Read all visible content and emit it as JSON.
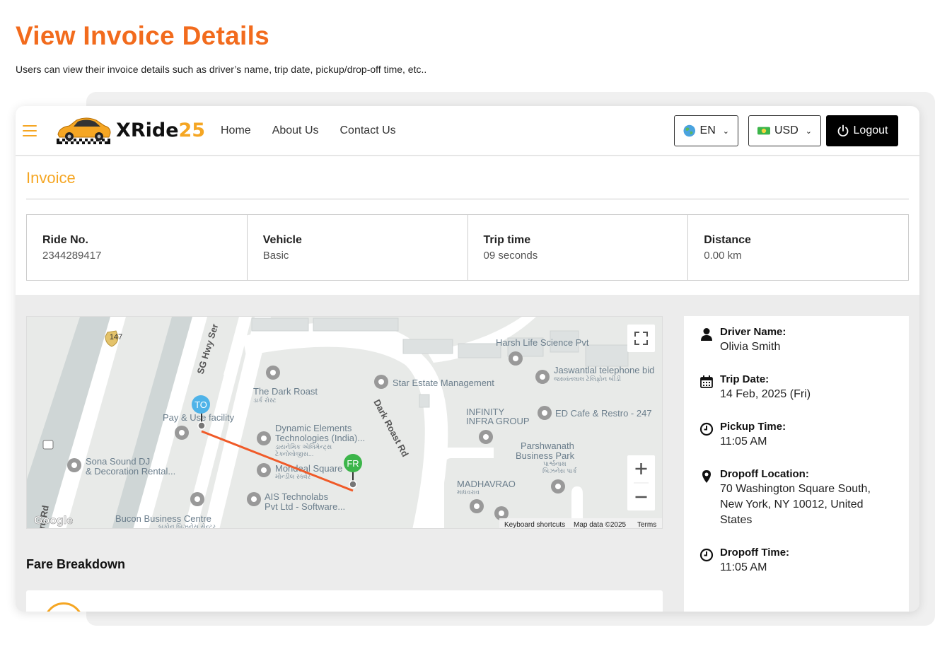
{
  "page": {
    "title": "View Invoice Details",
    "subtitle": "Users can view their invoice details such as driver’s name, trip date, pickup/drop-off time, etc.."
  },
  "navbar": {
    "logo_text": "XRide",
    "logo_number": "25",
    "links": [
      "Home",
      "About Us",
      "Contact Us"
    ],
    "language": "EN",
    "currency": "USD",
    "logout": "Logout"
  },
  "invoice": {
    "title": "Invoice",
    "stats": [
      {
        "label": "Ride No.",
        "value": "2344289417"
      },
      {
        "label": "Vehicle",
        "value": "Basic"
      },
      {
        "label": "Trip time",
        "value": "09 seconds"
      },
      {
        "label": "Distance",
        "value": "0.00 km"
      }
    ]
  },
  "map": {
    "highway_shield": "147",
    "to_marker": "TO",
    "from_marker": "FR",
    "labels": {
      "sg_hwy": "SG Hwy Ser",
      "dark_roast_rd": "Dark Roast Rd",
      "harsh": "Harsh Life Science Pvt",
      "jaswantlal": "Jaswantlal telephone bid",
      "jaswantlal_gu": "જસવંતલાલ ટેલિફોન બીડી",
      "star_estate": "Star Estate Management",
      "dark_roast": "The Dark Roast",
      "dark_roast_gu": "ડાર્ક રોસ્ટ",
      "infinity": "INFINITY",
      "infra": "INFRA GROUP",
      "ed_cafe": "ED Cafe & Restro - 247",
      "pay_use": "Pay & Use facility",
      "dynamic1": "Dynamic Elements",
      "dynamic2": "Technologies (India)...",
      "dynamic_gu1": "ડાયનેમિક એલિમેન્ટ્સ",
      "dynamic_gu2": "ટેક્નોલોજીસ...",
      "parshwanath1": "Parshwanath",
      "parshwanath2": "Business Park",
      "parshwanath_gu1": "પાર્શ્વનાથ",
      "parshwanath_gu2": "બિઝનેસ પાર્ક",
      "sona1": "Sona Sound DJ",
      "sona2": "& Decoration Rental...",
      "mondeal": "Mondeal Square",
      "mondeal_gu": "મોન્ડીલ સ્ક્વેર",
      "madhavrao": "MADHAVRAO",
      "madhavrao_gu": "માધવરાવ",
      "ais1": "AIS Technolabs",
      "ais2": "Pvt Ltd - Software...",
      "bucon": "Bucon Business Centre",
      "bucon_gu": "બુકોન બિઝનેસ સેન્ટર",
      "ru_rd": "ru Rd",
      "google": "Google",
      "keyboard": "Keyboard shortcuts",
      "map_data": "Map data ©2025",
      "terms": "Terms"
    }
  },
  "fare": {
    "title": "Fare Breakdown"
  },
  "trip_details": [
    {
      "icon": "person-icon",
      "label": "Driver Name:",
      "value": "Olivia Smith"
    },
    {
      "icon": "calendar-icon",
      "label": "Trip Date:",
      "value": "14 Feb, 2025 (Fri)"
    },
    {
      "icon": "clock-icon",
      "label": "Pickup Time:",
      "value": "11:05 AM"
    },
    {
      "icon": "location-pin-icon",
      "label": "Dropoff Location:",
      "value": "70 Washington Square South, New York, NY 10012, United States"
    },
    {
      "icon": "clock-icon",
      "label": "Dropoff Time:",
      "value": "11:05 AM"
    }
  ],
  "colors": {
    "accent_orange": "#f26b1d",
    "brand_yellow": "#f5a623",
    "route_line": "#f05a28",
    "to_marker": "#4fb3e8",
    "from_marker": "#3cb54a"
  }
}
